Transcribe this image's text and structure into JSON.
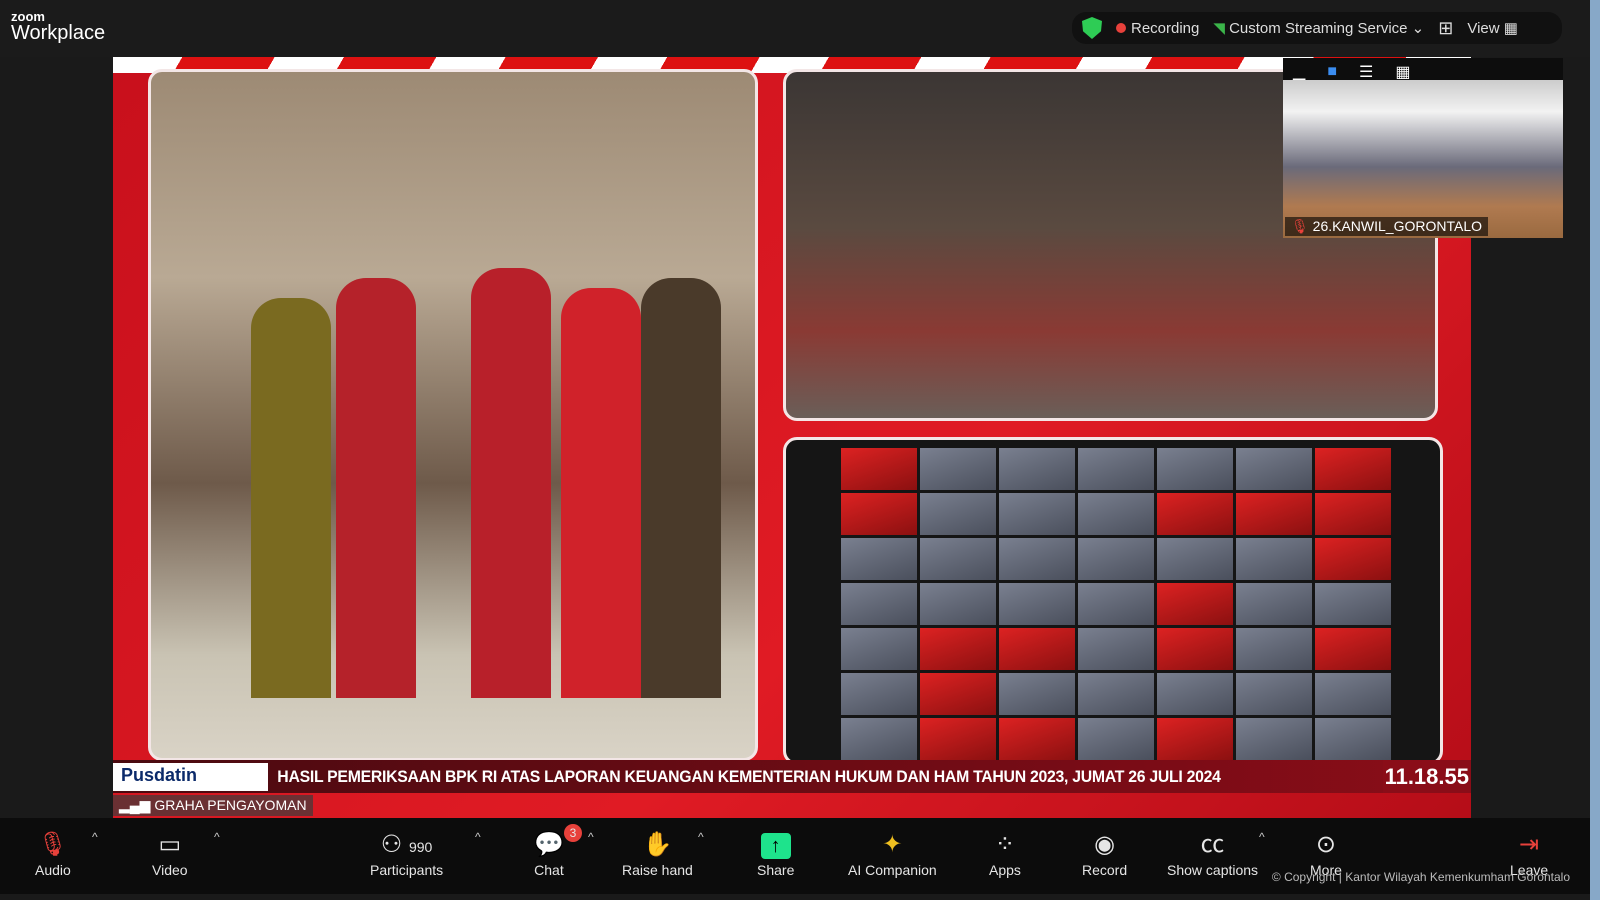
{
  "app": {
    "brand_small": "zoom",
    "brand": "Workplace"
  },
  "status": {
    "recording": "Recording",
    "streaming": "Custom Streaming Service",
    "view": "View"
  },
  "thumbnail": {
    "name": "26.KANWIL_GORONTALO"
  },
  "stage": {
    "logo": "Pusdatin",
    "ticker": "HASIL PEMERIKSAAN BPK RI ATAS LAPORAN KEUANGAN KEMENTERIAN HUKUM DAN HAM TAHUN 2023, JUMAT 26 JULI 2024",
    "clock": "11.18.55",
    "room": "GRAHA PENGAYOMAN"
  },
  "toolbar": {
    "audio": "Audio",
    "video": "Video",
    "participants": "Participants",
    "participants_count": "990",
    "chat": "Chat",
    "chat_badge": "3",
    "raise_hand": "Raise hand",
    "share": "Share",
    "ai": "AI Companion",
    "apps": "Apps",
    "record": "Record",
    "captions": "Show captions",
    "more": "More",
    "leave": "Leave"
  },
  "footer": {
    "copyright": "© Copyright | Kantor Wilayah Kemenkumham Gorontalo"
  },
  "colors": {
    "recording": "#e8413b",
    "share": "#1ee38c",
    "shield": "#2ecc55",
    "stage_red": "#e01b24"
  }
}
